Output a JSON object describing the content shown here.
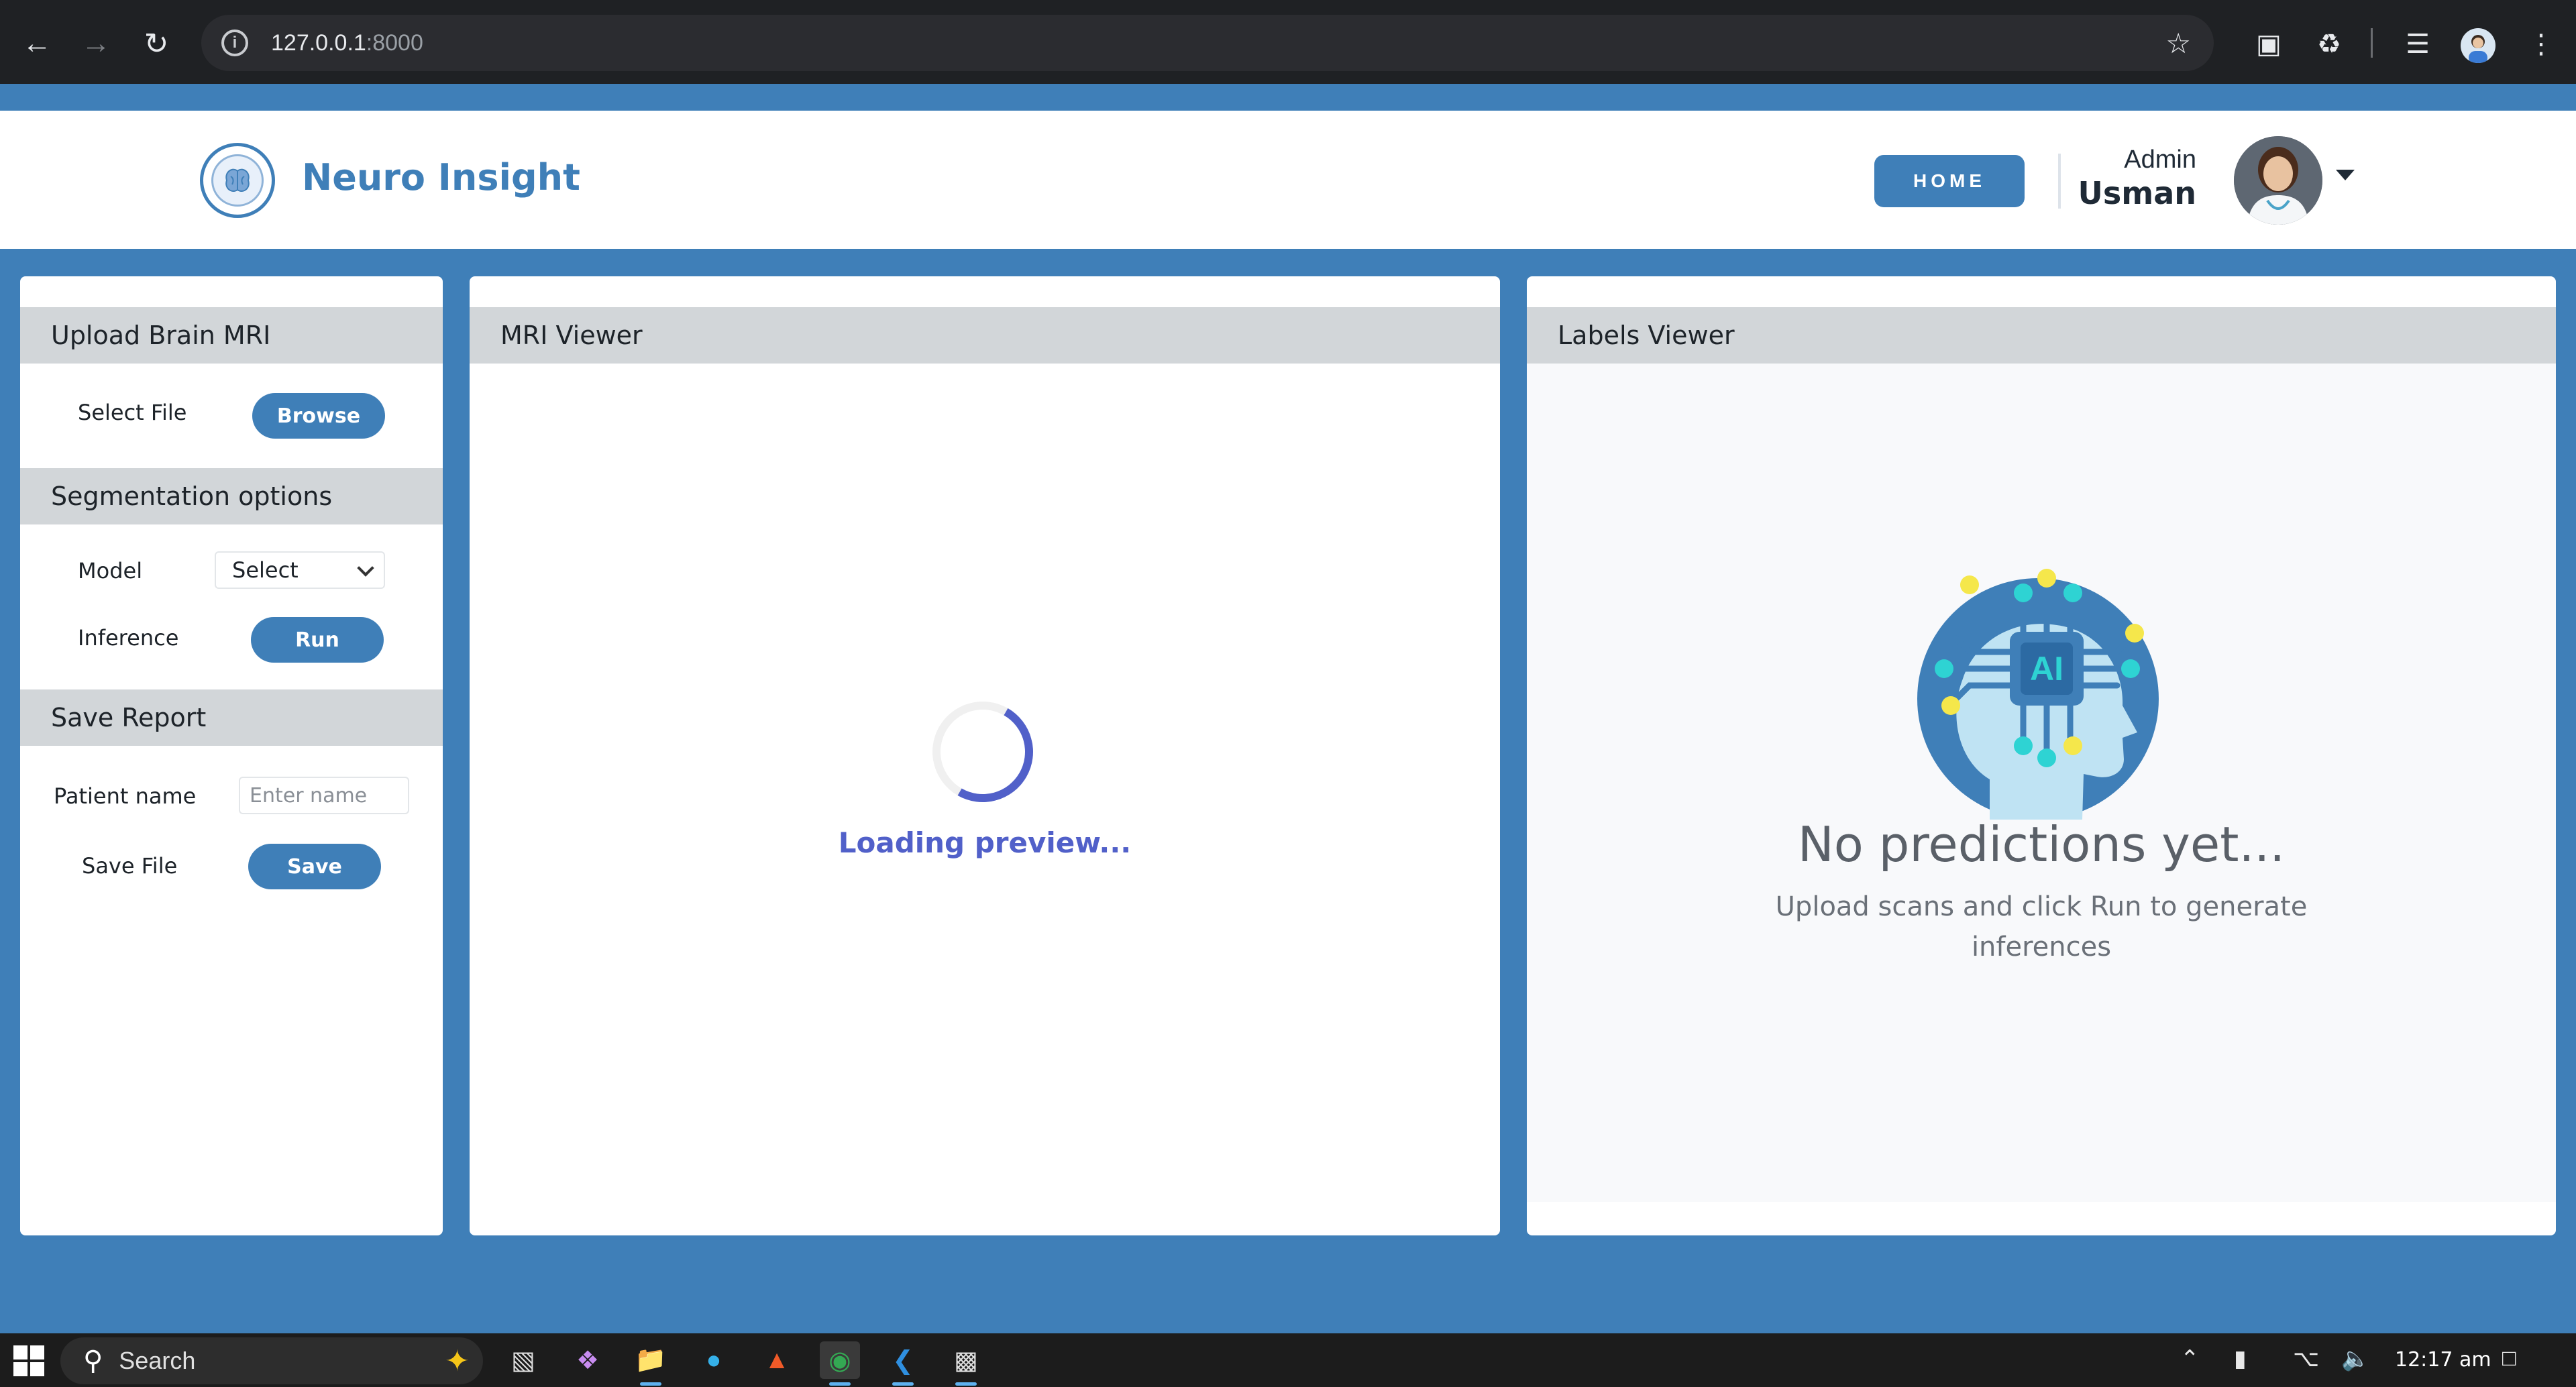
{
  "browser": {
    "url_host": "127.0.0.1",
    "url_port": ":8000"
  },
  "header": {
    "brand": "Neuro Insight",
    "home_label": "HOME",
    "user_role": "Admin",
    "user_name": "Usman"
  },
  "sidebar": {
    "upload_title": "Upload Brain MRI",
    "select_file_label": "Select File",
    "browse_label": "Browse",
    "seg_title": "Segmentation options",
    "model_label": "Model",
    "model_value": "Select",
    "inference_label": "Inference",
    "run_label": "Run",
    "report_title": "Save Report",
    "patient_label": "Patient name",
    "patient_placeholder": "Enter name",
    "save_file_label": "Save File",
    "save_label": "Save"
  },
  "mri_viewer": {
    "title": "MRI Viewer",
    "loading_text": "Loading preview..."
  },
  "labels_viewer": {
    "title": "Labels Viewer",
    "empty_title": "No predictions yet...",
    "empty_subtitle": "Upload scans and click Run to generate inferences",
    "illustration_text": "AI"
  },
  "taskbar": {
    "search_text": "Search",
    "clock": "12:17 am"
  },
  "colors": {
    "primary": "#3f7fb8",
    "loading": "#5160c9",
    "panel_header": "#d2d6d9"
  }
}
